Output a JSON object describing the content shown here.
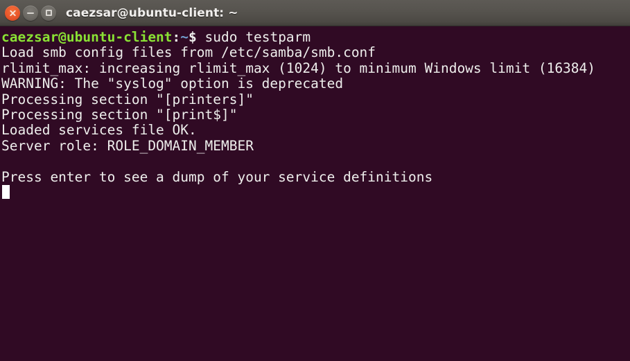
{
  "window": {
    "title": "caezsar@ubuntu-client: ~",
    "controls": {
      "close_label": "close-button",
      "minimize_label": "minimize-button",
      "maximize_label": "maximize-button"
    },
    "colors": {
      "terminal_background": "#300a24",
      "titlebar_top": "#5d5a55",
      "titlebar_bottom": "#413e3a",
      "text": "#eeeeec",
      "prompt_user_host": "#8ae234",
      "prompt_path": "#729fcf",
      "close_button": "#e8552a",
      "cursor": "#ffffff"
    }
  },
  "terminal": {
    "prompt": {
      "user_host": "caezsar@ubuntu-client",
      "colon": ":",
      "path": "~",
      "sigil": "$",
      "command": " sudo testparm"
    },
    "output_lines": [
      "Load smb config files from /etc/samba/smb.conf",
      "rlimit_max: increasing rlimit_max (1024) to minimum Windows limit (16384)",
      "WARNING: The \"syslog\" option is deprecated",
      "Processing section \"[printers]\"",
      "Processing section \"[print$]\"",
      "Loaded services file OK.",
      "Server role: ROLE_DOMAIN_MEMBER",
      "",
      "Press enter to see a dump of your service definitions"
    ],
    "cursor": "block-cursor"
  }
}
